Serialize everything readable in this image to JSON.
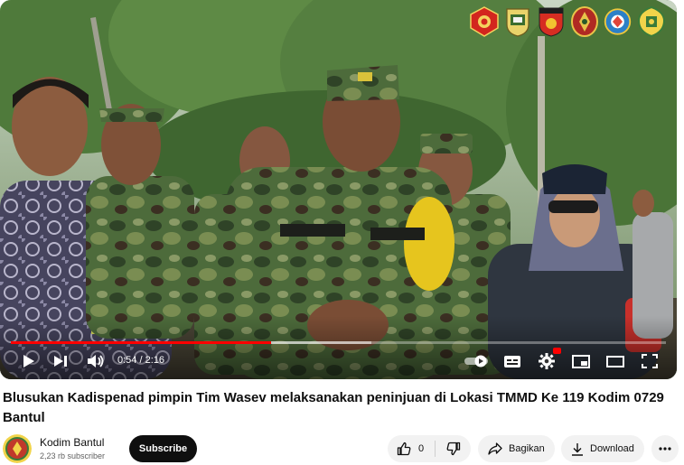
{
  "video": {
    "current_time": "0:54",
    "duration": "2:16",
    "time_separator": " / ",
    "progress_fraction": 0.397,
    "buffer_fraction": 0.55,
    "progress_color": "#ff0000"
  },
  "overlay_logos": [
    "red-emblem-icon",
    "army-emblem-icon",
    "diponegoro-emblem-icon",
    "kodam-emblem-icon",
    "blue-emblem-icon",
    "bantul-emblem-icon"
  ],
  "badge_texts": [
    "SIG",
    "TNI AD",
    "THI AD",
    "TNI",
    "P.SANTURI",
    "DPMK"
  ],
  "title": "Blusukan Kadispenad pimpin Tim Wasev melaksanakan peninjuan di Lokasi TMMD Ke 119 Kodim 0729 Bantul",
  "channel": {
    "name": "Kodim Bantul",
    "subscribers": "2,23 rb subscriber",
    "subscribe_label": "Subscribe"
  },
  "actions": {
    "like_count": "0",
    "share_label": "Bagikan",
    "download_label": "Download"
  },
  "colors": {
    "subscribe_bg": "#0f0f0f",
    "pill_bg": "#f2f2f2",
    "accent": "#ff0000"
  }
}
